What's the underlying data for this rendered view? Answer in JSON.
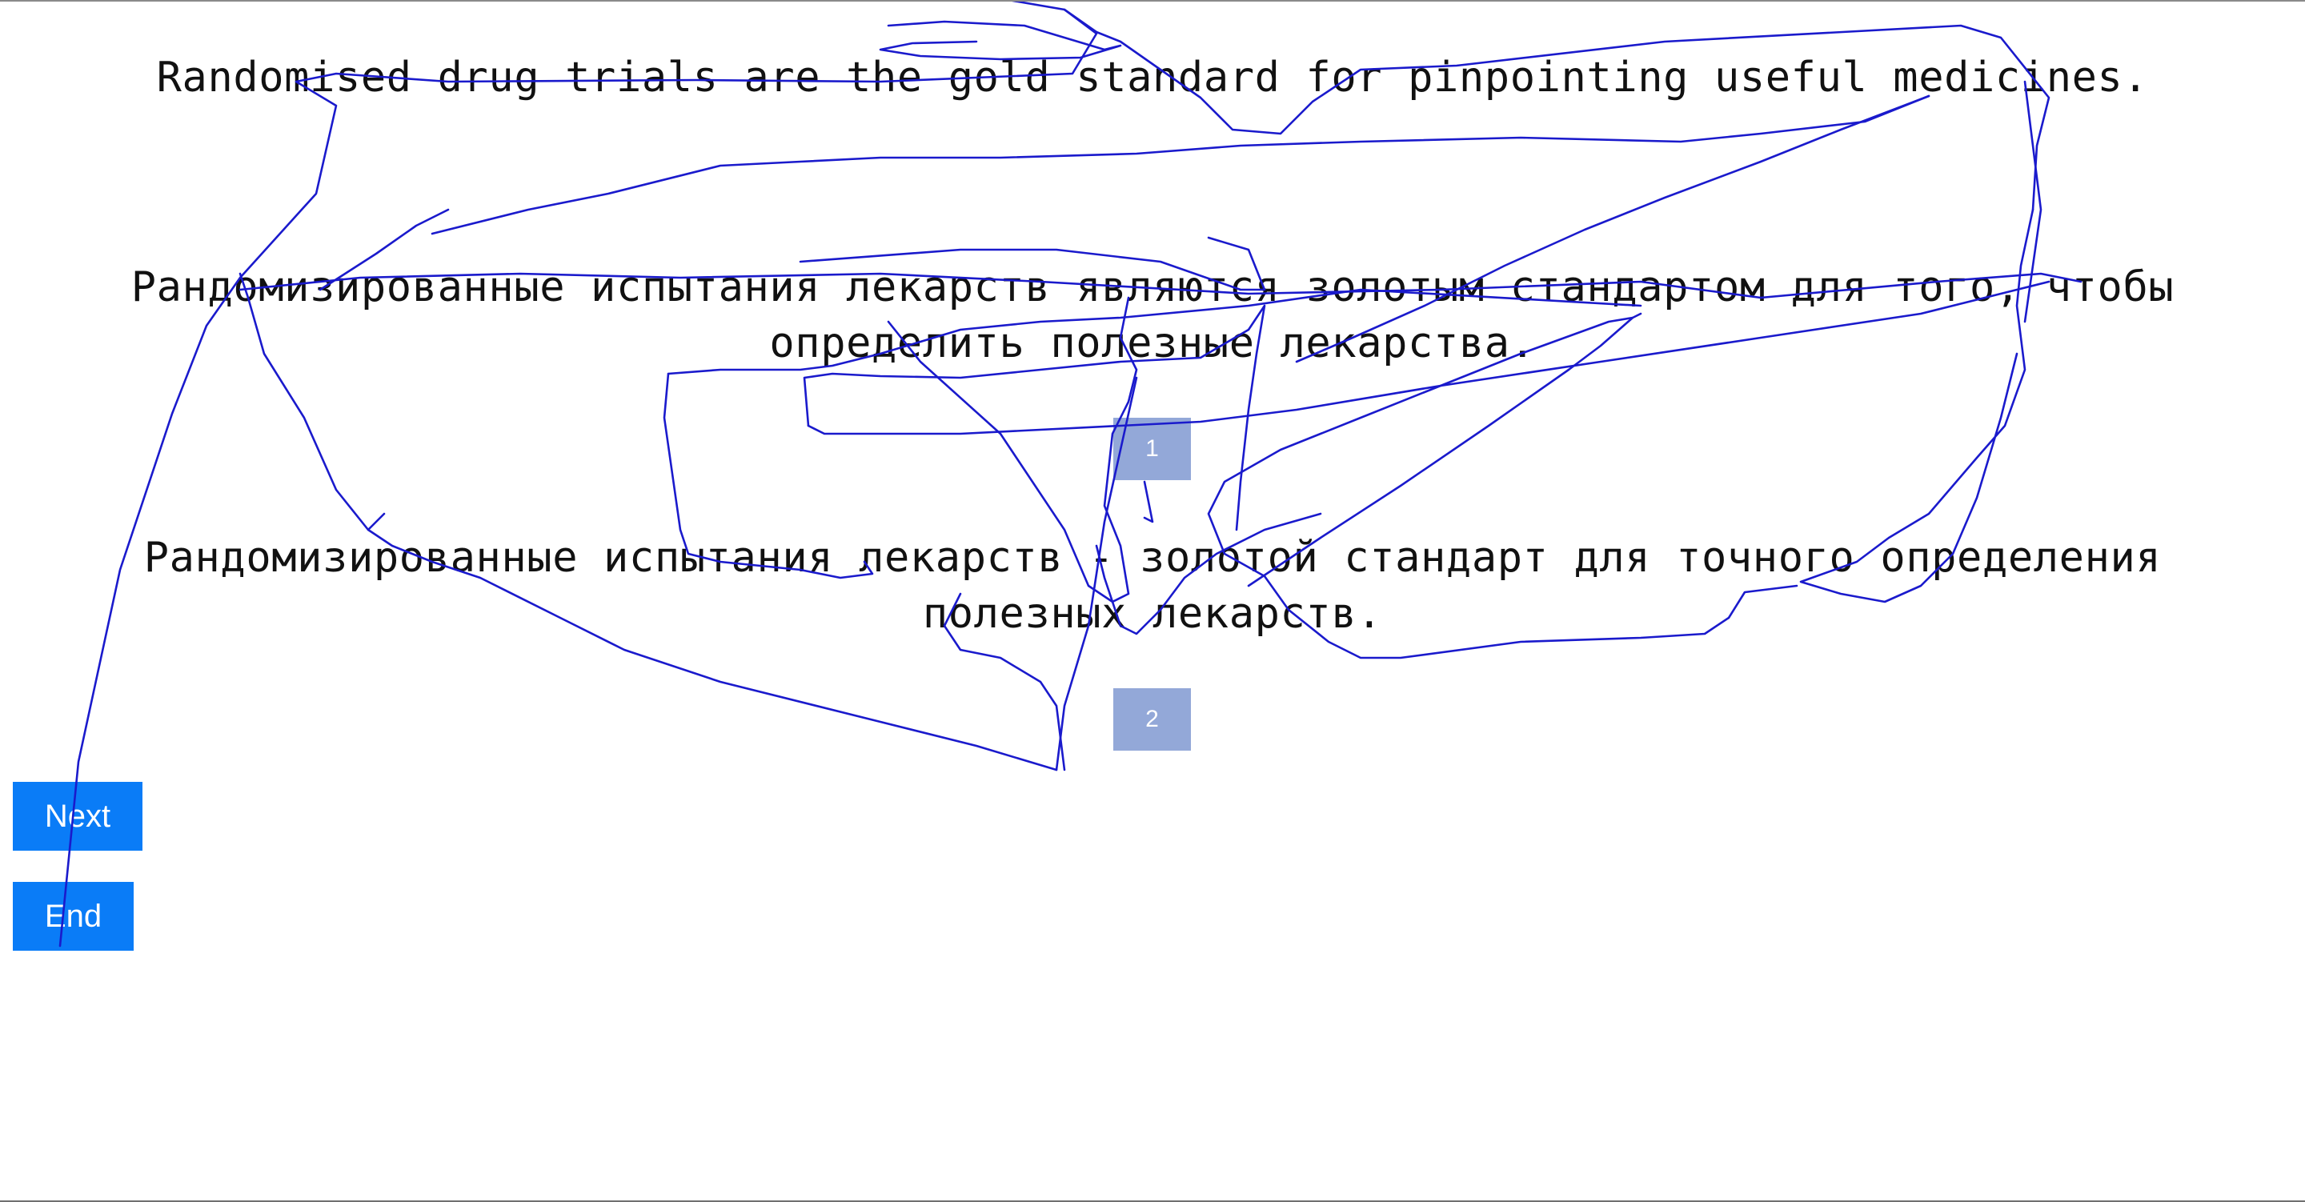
{
  "source_sentence": "Randomised drug trials are the gold standard for pinpointing useful medicines.",
  "translations": [
    {
      "rank_label": "1",
      "text": "Рандомизированные испытания лекарств являются золотым стандартом для того, чтобы определить полезные лекарства."
    },
    {
      "rank_label": "2",
      "text": "Рандомизированные испытания лекарств - золотой стандарт для точного определения полезных лекарств."
    }
  ],
  "buttons": {
    "next_label": "Next",
    "end_label": "End"
  },
  "colors": {
    "button_bg": "#0a7cf7",
    "rank_box_bg": "#93a8d8",
    "scribble_stroke": "#1a1acc"
  }
}
